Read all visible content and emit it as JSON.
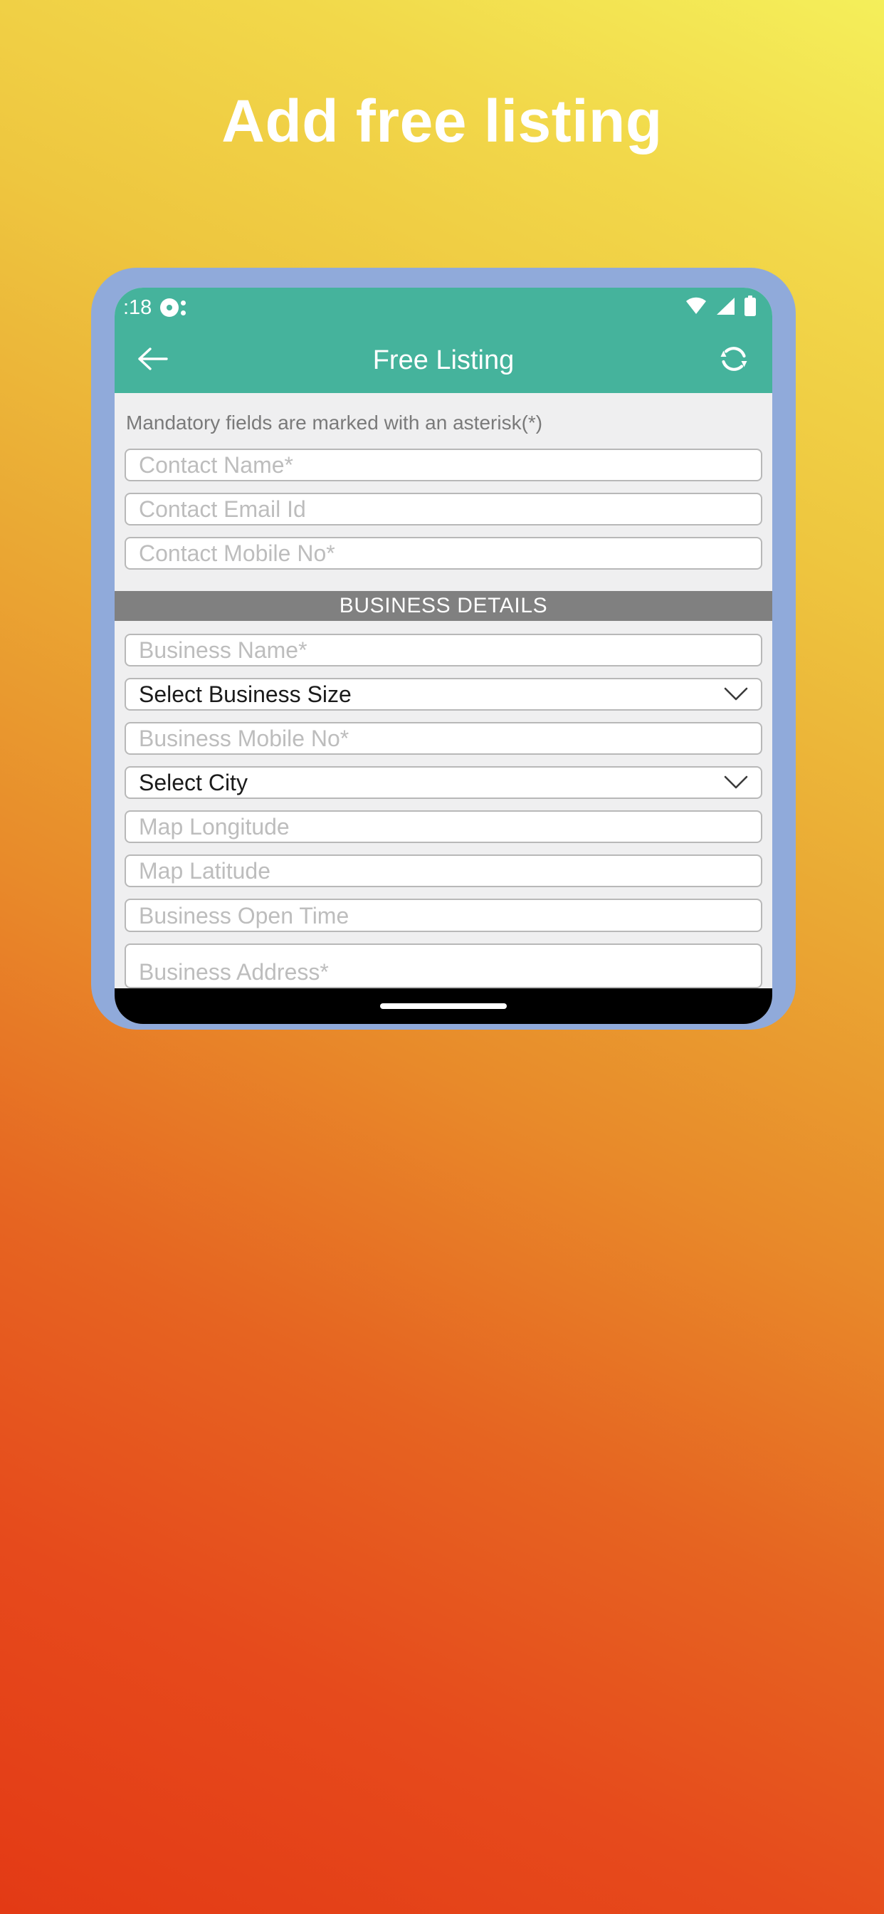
{
  "poster": {
    "headline": "Add free listing",
    "gradient_from": "#f4ef5a",
    "gradient_to": "#e33a15",
    "frame_color": "#90aada"
  },
  "phone": {
    "status_bar": {
      "time": ":18",
      "notification_icon": "record-dot-icon",
      "wifi_icon": "wifi-icon",
      "signal_icon": "cellular-signal-icon",
      "battery_icon": "battery-full-icon",
      "background": "#45b39c"
    },
    "app_bar": {
      "back_icon": "arrow-left-icon",
      "title": "Free Listing",
      "refresh_icon": "refresh-icon",
      "background": "#45b39c"
    },
    "nav_bar": {
      "home_indicator": "home-indicator"
    }
  },
  "form": {
    "mandatory_note": "Mandatory fields are marked with an asterisk(*)",
    "contact_fields": [
      {
        "name": "contact-name",
        "placeholder": "Contact Name*",
        "type": "text",
        "value": ""
      },
      {
        "name": "contact-email",
        "placeholder": "Contact Email Id",
        "type": "text",
        "value": ""
      },
      {
        "name": "contact-mobile",
        "placeholder": "Contact Mobile No*",
        "type": "text",
        "value": ""
      }
    ],
    "section_header": "BUSINESS DETAILS",
    "section_header_color": "#808080",
    "business_fields": [
      {
        "name": "business-name",
        "placeholder": "Business Name*",
        "type": "text",
        "value": ""
      },
      {
        "name": "business-size",
        "placeholder": "Select Business Size",
        "type": "select",
        "value": "Select Business Size"
      },
      {
        "name": "business-mobile",
        "placeholder": "Business Mobile No*",
        "type": "text",
        "value": ""
      },
      {
        "name": "city",
        "placeholder": "Select City",
        "type": "select",
        "value": "Select City"
      },
      {
        "name": "map-longitude",
        "placeholder": "Map Longitude",
        "type": "text",
        "value": ""
      },
      {
        "name": "map-latitude",
        "placeholder": "Map Latitude",
        "type": "text",
        "value": ""
      },
      {
        "name": "business-open-time",
        "placeholder": "Business Open Time",
        "type": "text",
        "value": ""
      },
      {
        "name": "business-address",
        "placeholder": "Business Address*",
        "type": "textarea",
        "value": ""
      }
    ]
  }
}
